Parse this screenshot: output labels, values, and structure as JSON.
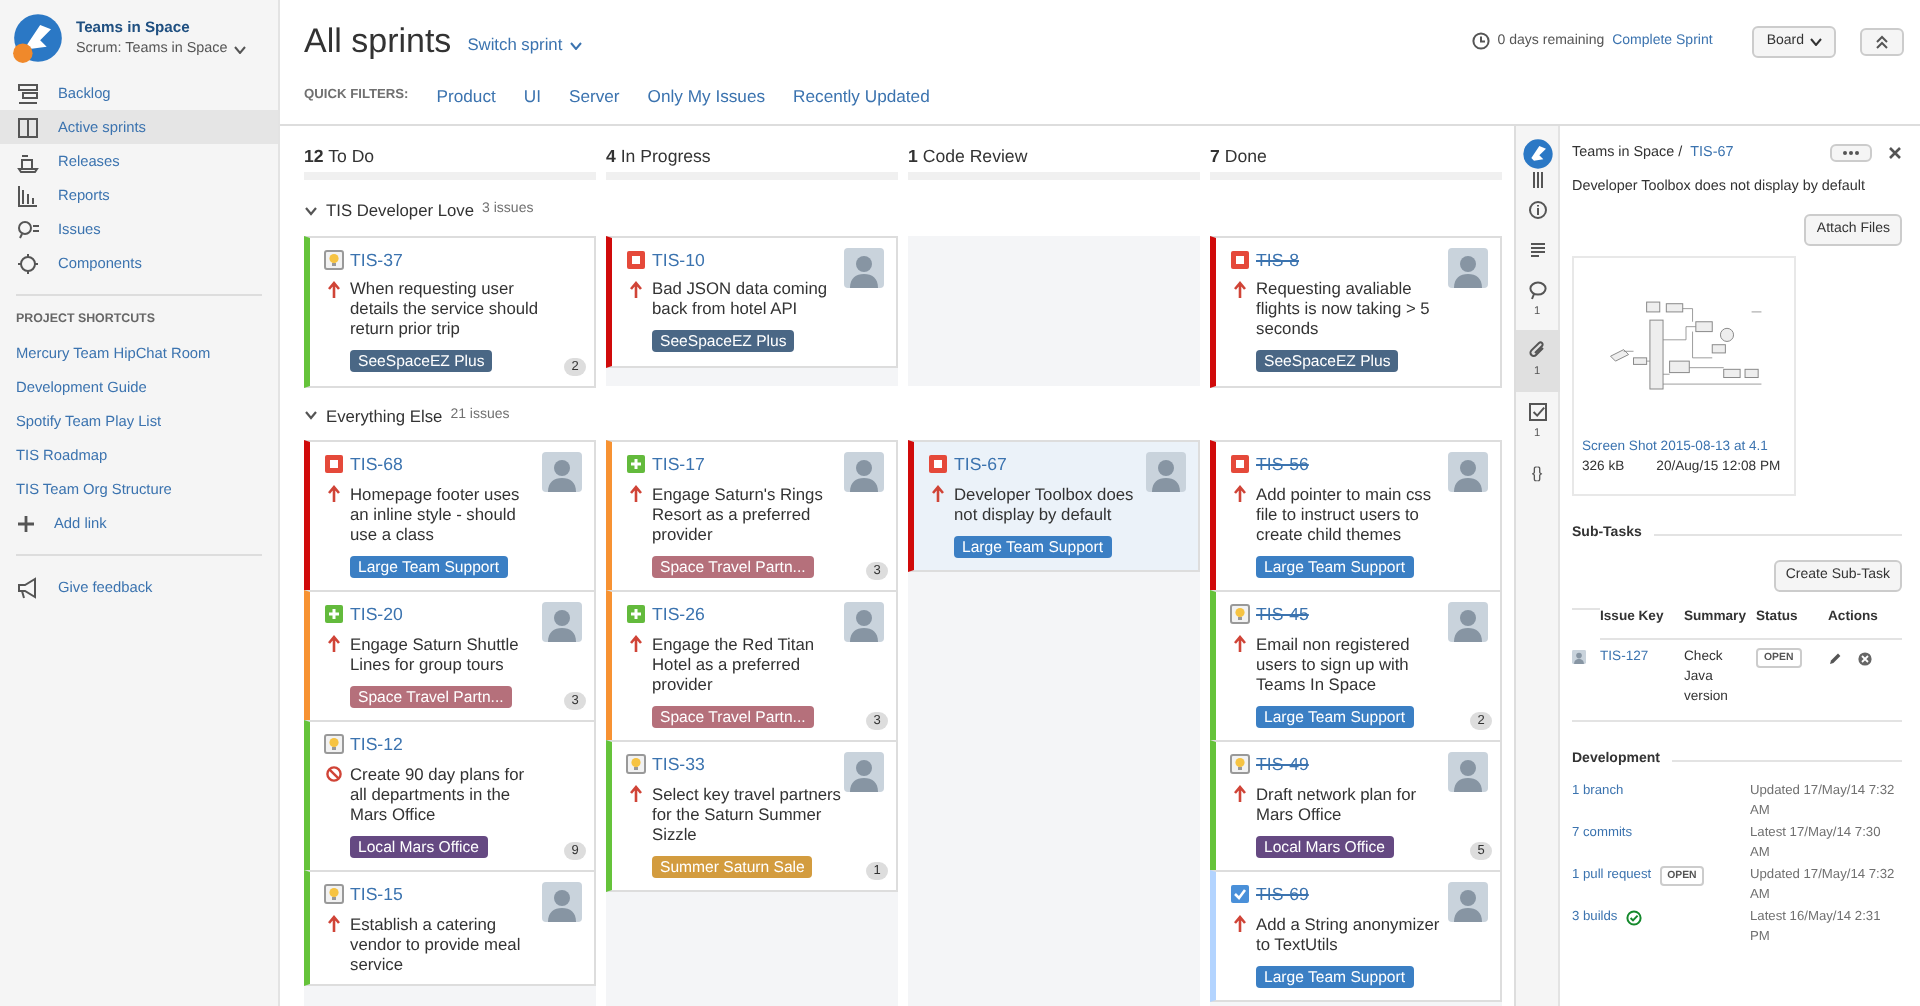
{
  "sidebar": {
    "project": {
      "name": "Teams in Space",
      "board": "Scrum: Teams in Space"
    },
    "nav": [
      {
        "label": "Backlog",
        "kind": "backlog",
        "selected": false
      },
      {
        "label": "Active sprints",
        "kind": "sprints",
        "selected": true
      },
      {
        "label": "Releases",
        "kind": "releases",
        "selected": false
      },
      {
        "label": "Reports",
        "kind": "reports",
        "selected": false
      },
      {
        "label": "Issues",
        "kind": "issues",
        "selected": false
      },
      {
        "label": "Components",
        "kind": "components",
        "selected": false
      }
    ],
    "shortcuts_heading": "PROJECT SHORTCUTS",
    "shortcuts": [
      "Mercury Team HipChat Room",
      "Development Guide",
      "Spotify Team Play List",
      "TIS Roadmap",
      "TIS Team Org Structure"
    ],
    "add_link": "Add link",
    "feedback": "Give feedback"
  },
  "header": {
    "title": "All sprints",
    "switch_sprint": "Switch sprint",
    "days_remaining": "0 days remaining",
    "complete_sprint": "Complete Sprint",
    "board_button": "Board"
  },
  "quick_filters": {
    "label": "QUICK FILTERS:",
    "items": [
      "Product",
      "UI",
      "Server",
      "Only My Issues",
      "Recently Updated"
    ]
  },
  "columns": [
    {
      "count": "12",
      "name": "To Do"
    },
    {
      "count": "4",
      "name": "In Progress"
    },
    {
      "count": "1",
      "name": "Code Review"
    },
    {
      "count": "7",
      "name": "Done"
    }
  ],
  "swimlanes": [
    {
      "name": "TIS Developer Love",
      "count": "3 issues",
      "expanded": true,
      "cells": [
        [
          {
            "key": "TIS-37",
            "kind": "suggestion",
            "blocked": false,
            "summary": "When requesting user details the service should return prior trip",
            "epic": {
              "label": "SeeSpaceEZ Plus",
              "color": "#4a6785"
            },
            "count": "2",
            "avatar": false,
            "color": "#65c33a",
            "done": false,
            "selected": false
          }
        ],
        [
          {
            "key": "TIS-10",
            "kind": "bug",
            "blocked": false,
            "summary": "Bad JSON data coming back from hotel API",
            "epic": {
              "label": "SeeSpaceEZ Plus",
              "color": "#4a6785"
            },
            "avatar": true,
            "color": "#d00a0a",
            "done": false,
            "selected": false
          }
        ],
        [],
        [
          {
            "key": "TIS-8",
            "kind": "bug",
            "blocked": false,
            "summary": "Requesting avaliable flights is now taking > 5 seconds",
            "epic": {
              "label": "SeeSpaceEZ Plus",
              "color": "#4a6785"
            },
            "avatar": true,
            "color": "#d00a0a",
            "done": true,
            "selected": false
          }
        ]
      ]
    },
    {
      "name": "Everything Else",
      "count": "21 issues",
      "expanded": true,
      "cells": [
        [
          {
            "key": "TIS-68",
            "kind": "bug",
            "blocked": false,
            "summary": "Homepage footer uses an inline style - should use a class",
            "epic": {
              "label": "Large Team Support",
              "color": "#3b7fc4"
            },
            "avatar": true,
            "color": "#d00a0a",
            "done": false,
            "selected": false
          },
          {
            "key": "TIS-20",
            "kind": "improvement",
            "blocked": false,
            "summary": "Engage Saturn Shuttle Lines for group tours",
            "epic": {
              "label": "Space Travel Partn...",
              "color": "#b5707b"
            },
            "count": "3",
            "avatar": true,
            "color": "#f79232",
            "done": false,
            "selected": false
          },
          {
            "key": "TIS-12",
            "kind": "suggestion",
            "blocked": true,
            "summary": "Create 90 day plans for all departments in the Mars Office",
            "epic": {
              "label": "Local Mars Office",
              "color": "#654982"
            },
            "count": "9",
            "avatar": false,
            "color": "#65c33a",
            "done": false,
            "selected": false
          },
          {
            "key": "TIS-15",
            "kind": "suggestion",
            "blocked": false,
            "summary": "Establish a catering vendor to provide meal service",
            "avatar": true,
            "color": "#65c33a",
            "done": false,
            "selected": false
          }
        ],
        [
          {
            "key": "TIS-17",
            "kind": "improvement",
            "blocked": false,
            "summary": "Engage Saturn's Rings Resort as a preferred provider",
            "epic": {
              "label": "Space Travel Partn...",
              "color": "#b5707b"
            },
            "count": "3",
            "avatar": true,
            "color": "#f79232",
            "done": false,
            "selected": false
          },
          {
            "key": "TIS-26",
            "kind": "improvement",
            "blocked": false,
            "summary": "Engage the Red Titan Hotel as a preferred provider",
            "epic": {
              "label": "Space Travel Partn...",
              "color": "#b5707b"
            },
            "count": "3",
            "avatar": true,
            "color": "#f79232",
            "done": false,
            "selected": false
          },
          {
            "key": "TIS-33",
            "kind": "suggestion",
            "blocked": false,
            "summary": "Select key travel partners for the Saturn Summer Sizzle",
            "epic": {
              "label": "Summer Saturn Sale",
              "color": "#d39c3f"
            },
            "count": "1",
            "avatar": true,
            "color": "#65c33a",
            "done": false,
            "selected": false
          }
        ],
        [
          {
            "key": "TIS-67",
            "kind": "bug",
            "blocked": false,
            "summary": "Developer Toolbox does not display by default",
            "epic": {
              "label": "Large Team Support",
              "color": "#3b7fc4"
            },
            "avatar": true,
            "color": "#d00a0a",
            "done": false,
            "selected": true
          }
        ],
        [
          {
            "key": "TIS-56",
            "kind": "bug",
            "blocked": false,
            "summary": "Add pointer to main css file to instruct users to create child themes",
            "epic": {
              "label": "Large Team Support",
              "color": "#3b7fc4"
            },
            "avatar": true,
            "color": "#d00a0a",
            "done": true,
            "selected": false
          },
          {
            "key": "TIS-45",
            "kind": "suggestion",
            "blocked": false,
            "summary": "Email non registered users to sign up with Teams In Space",
            "epic": {
              "label": "Large Team Support",
              "color": "#3b7fc4"
            },
            "count": "2",
            "avatar": true,
            "color": "#65c33a",
            "done": true,
            "selected": false
          },
          {
            "key": "TIS-49",
            "kind": "suggestion",
            "blocked": false,
            "summary": "Draft network plan for Mars Office",
            "epic": {
              "label": "Local Mars Office",
              "color": "#654982"
            },
            "count": "5",
            "avatar": true,
            "color": "#65c33a",
            "done": true,
            "selected": false
          },
          {
            "key": "TIS-69",
            "kind": "task",
            "blocked": false,
            "summary": "Add a String anonymizer to TextUtils",
            "epic": {
              "label": "Large Team Support",
              "color": "#3b7fc4"
            },
            "avatar": true,
            "color": "#b3d4ff",
            "done": true,
            "selected": false
          }
        ]
      ]
    }
  ],
  "detail": {
    "strip": [
      {
        "kind": "info",
        "selected": false
      },
      {
        "kind": "description",
        "selected": false
      },
      {
        "kind": "comment",
        "count": "1",
        "selected": false
      },
      {
        "kind": "attachment",
        "count": "1",
        "selected": true
      },
      {
        "kind": "subtask",
        "count": "1",
        "selected": false
      },
      {
        "kind": "glyph",
        "text": "{}",
        "selected": false
      }
    ],
    "project": "Teams in Space /",
    "key": "TIS-67",
    "summary": "Developer Toolbox does not display by default",
    "attach_button": "Attach Files",
    "attachment": {
      "name": "Screen Shot 2015-08-13 at 4.1",
      "size": "326 kB",
      "date": "20/Aug/15 12:08 PM"
    },
    "subtasks": {
      "heading": "Sub-Tasks",
      "create_button": "Create Sub-Task",
      "columns": [
        "Issue Key",
        "Summary",
        "Status",
        "Actions"
      ],
      "rows": [
        {
          "key": "TIS-127",
          "summary": "Check Java version",
          "status": "OPEN"
        }
      ]
    },
    "development": {
      "heading": "Development",
      "items": [
        {
          "link": "1 branch",
          "info": "Updated 17/May/14 7:32 AM"
        },
        {
          "link": "7 commits",
          "info": "Latest 17/May/14 7:30 AM"
        },
        {
          "link": "1 pull request",
          "lozenge": "OPEN",
          "info": "Updated 17/May/14 7:32 AM"
        },
        {
          "link": "3 builds",
          "passed": true,
          "info": "Latest 16/May/14 2:31 PM"
        }
      ]
    }
  }
}
